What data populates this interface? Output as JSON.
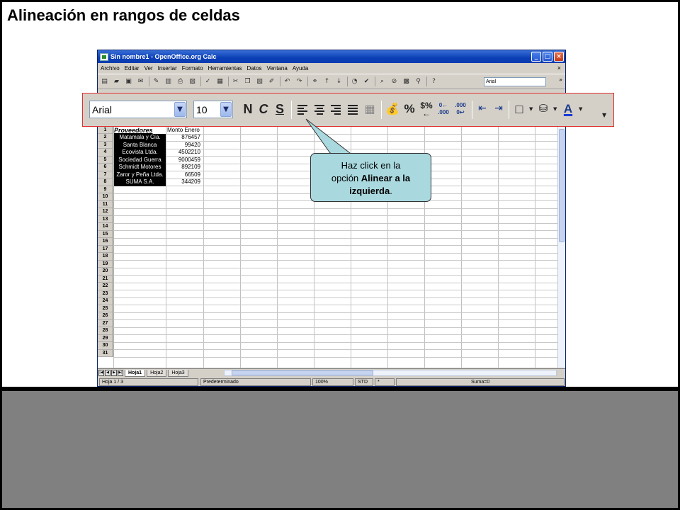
{
  "slide": {
    "title": "Alineación en rangos de celdas"
  },
  "window": {
    "title": "Sin nombre1 - OpenOffice.org Calc"
  },
  "menu": [
    "Archivo",
    "Editar",
    "Ver",
    "Insertar",
    "Formato",
    "Herramientas",
    "Datos",
    "Ventana",
    "Ayuda"
  ],
  "toolbar": {
    "font_name": "Arial",
    "font_size": "10",
    "bold_label": "N",
    "italic_label": "C",
    "underline_label": "S"
  },
  "sheet": {
    "header_name": "Proveedores",
    "header_value": "Monto Enero",
    "rows": [
      {
        "name": "Matamala y Cía.",
        "value": "876457"
      },
      {
        "name": "Santa Blanca",
        "value": "99420"
      },
      {
        "name": "Ecovista Ltda.",
        "value": "4502210"
      },
      {
        "name": "Sociedad Guerra",
        "value": "9000459"
      },
      {
        "name": "Schmidt Motores",
        "value": "892109"
      },
      {
        "name": "Zaror y Peña Ltda.",
        "value": "66509"
      },
      {
        "name": "SUMA S.A.",
        "value": "344209"
      }
    ],
    "row_numbers": [
      "1",
      "2",
      "3",
      "4",
      "5",
      "6",
      "7",
      "8",
      "9",
      "10",
      "11",
      "12",
      "13",
      "14",
      "15",
      "16",
      "17",
      "18",
      "19",
      "20",
      "21",
      "22",
      "23",
      "24",
      "25",
      "26",
      "27",
      "28",
      "29",
      "30",
      "31"
    ]
  },
  "tabs": [
    "Hoja1",
    "Hoja2",
    "Hoja3"
  ],
  "status": {
    "sheet": "Hoja 1 / 3",
    "style": "Predeterminado",
    "zoom": "100%",
    "mode": "STD",
    "modified": "*",
    "sum": "Suma=0"
  },
  "callout": {
    "line1": "Haz click en la",
    "line2_pre": "opción",
    "line2_bold": "Alinear a la",
    "line3_bold": "izquierda",
    "line3_post": "."
  }
}
